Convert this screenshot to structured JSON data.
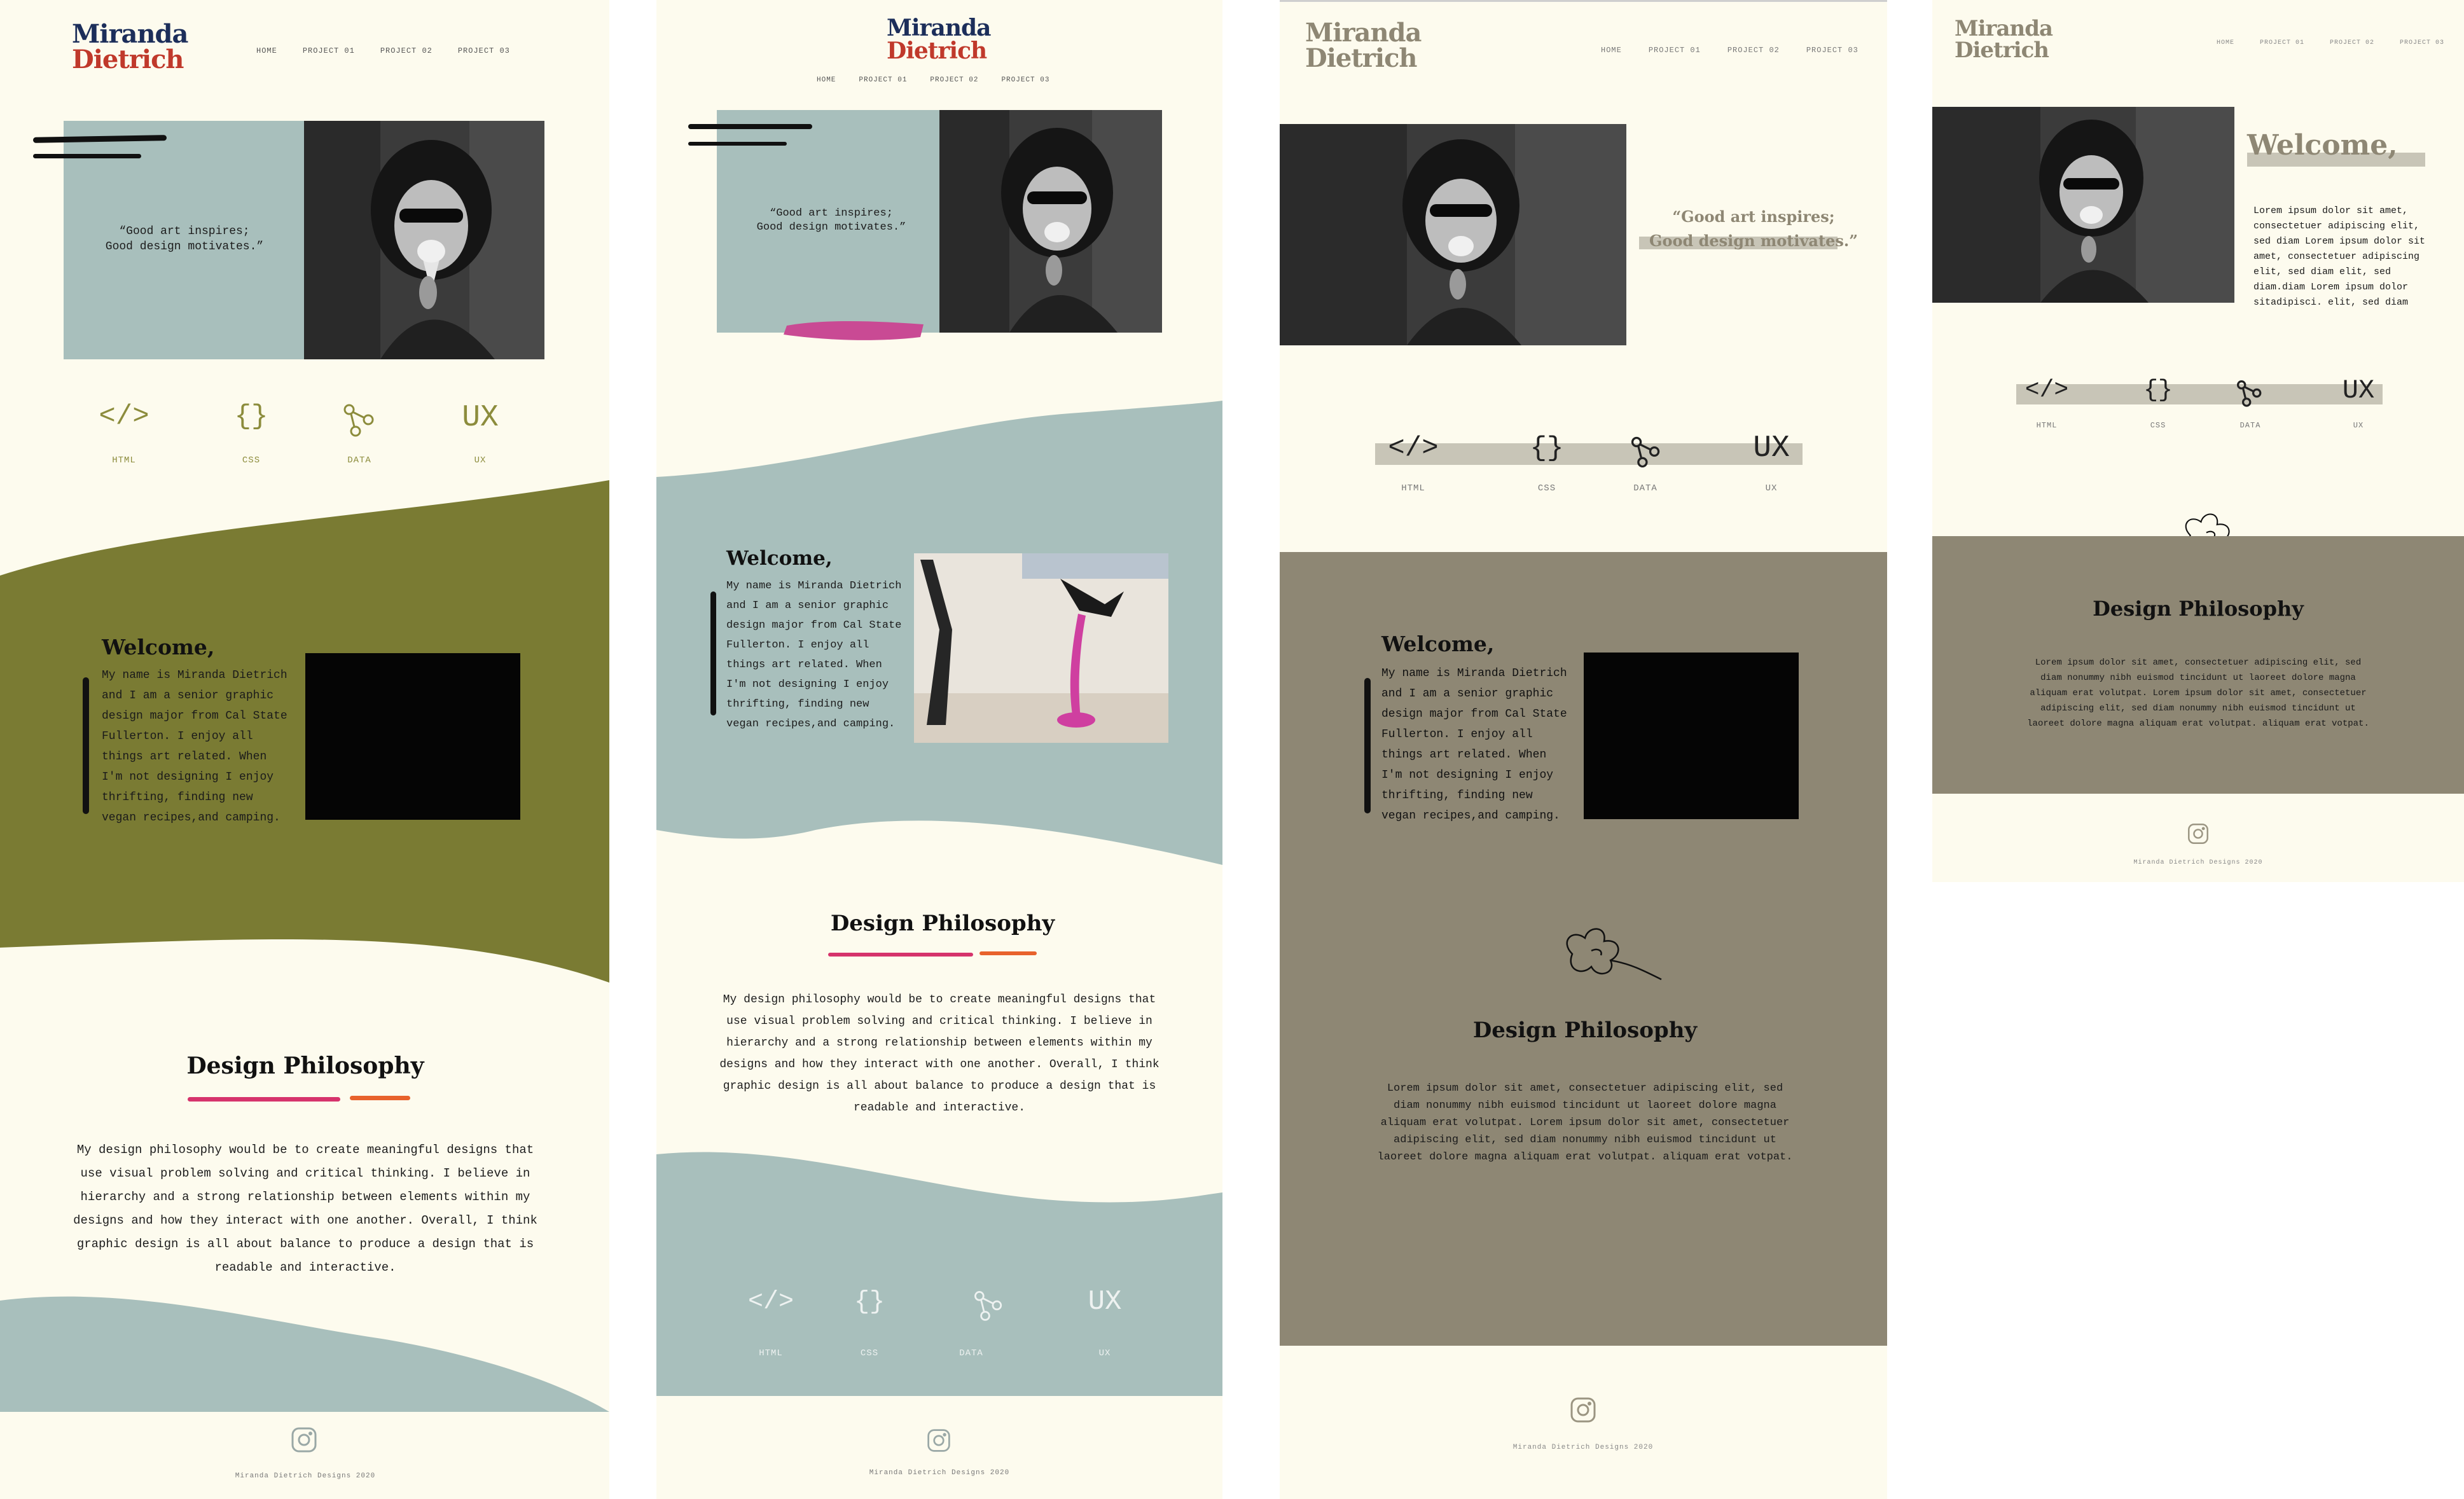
{
  "brand": {
    "name_line1": "Miranda",
    "name_line2": "Dietrich",
    "footer": "Miranda Dietrich Designs 2020"
  },
  "nav": [
    "HOME",
    "PROJECT 01",
    "PROJECT 02",
    "PROJECT 03"
  ],
  "hero": {
    "quote_line1": "“Good art inspires;",
    "quote_line2": "Good design motivates.”"
  },
  "skills": [
    {
      "icon": "code-icon",
      "glyph": "</>",
      "label": "HTML"
    },
    {
      "icon": "braces-icon",
      "glyph": "{}",
      "label": "CSS"
    },
    {
      "icon": "share-nodes-icon",
      "glyph": "",
      "label": "DATA"
    },
    {
      "icon": "ux-icon",
      "glyph": "UX",
      "label": "UX"
    }
  ],
  "welcome": {
    "heading": "Welcome,",
    "lines": [
      "My name is Miranda Dietrich",
      "and I am a senior graphic",
      "design major from Cal State",
      "Fullerton. I enjoy all",
      "things art related. When",
      "I'm not designing I enjoy",
      "thrifting, finding new",
      "vegan recipes,and camping."
    ]
  },
  "philosophy": {
    "heading": "Design Philosophy",
    "lines": [
      "My design philosophy would be to create meaningful designs that",
      "use visual problem solving and critical thinking. I believe in",
      "hierarchy and a strong relationship between elements within my",
      "designs and how they interact with one another. Overall, I think",
      "graphic design is all about balance to produce a design that is",
      "readable and interactive."
    ],
    "lines_v2": [
      "My design philosophy would be to create meaningful designs that",
      "use visual problem solving and critical thinking. I believe in",
      "hierarchy and a strong relationship between elements within my",
      "designs and how they interact with one another. Overall, I think",
      "graphic design is all about balance to produce a design that is",
      "readable and interactive."
    ]
  },
  "lorem_philosophy": [
    "Lorem ipsum dolor sit amet, consectetuer adipiscing elit, sed",
    "diam nonummy nibh euismod tincidunt ut laoreet dolore magna",
    "aliquam erat volutpat. Lorem ipsum dolor sit amet, consectetuer",
    "adipiscing elit, sed diam nonummy nibh euismod tincidunt ut",
    "laoreet dolore magna aliquam erat volutpat. aliquam erat votpat."
  ],
  "lorem_philosophy_v4": [
    "Lorem ipsum dolor sit amet, consectetuer adipiscing elit, sed",
    "diam nonummy nibh euismod tincidunt ut laoreet dolore magna",
    "aliquam erat volutpat. Lorem ipsum dolor sit amet, consectetuer",
    "adipiscing elit, sed diam nonummy nibh euismod tincidunt ut",
    "laoreet dolore magna aliquam erat volutpat. aliquam erat votpat."
  ],
  "lorem_welcome": [
    "Lorem ipsum dolor sit amet,",
    "consectetuer adipiscing elit,",
    "sed diam Lorem ipsum dolor sit",
    "amet, consectetuer adipiscing",
    "elit, sed diam elit, sed",
    "diam.diam Lorem ipsum dolor",
    "sitadipisci. elit, sed diam"
  ],
  "colors": {
    "cream": "#fdfbee",
    "olive": "#7a7b33",
    "sage": "#a8bfbc",
    "taupe": "#8e8774",
    "pink": "#d6336c",
    "orange": "#e8622c",
    "navy": "#1c2e5a",
    "gray_band": "#c8c5b7"
  }
}
